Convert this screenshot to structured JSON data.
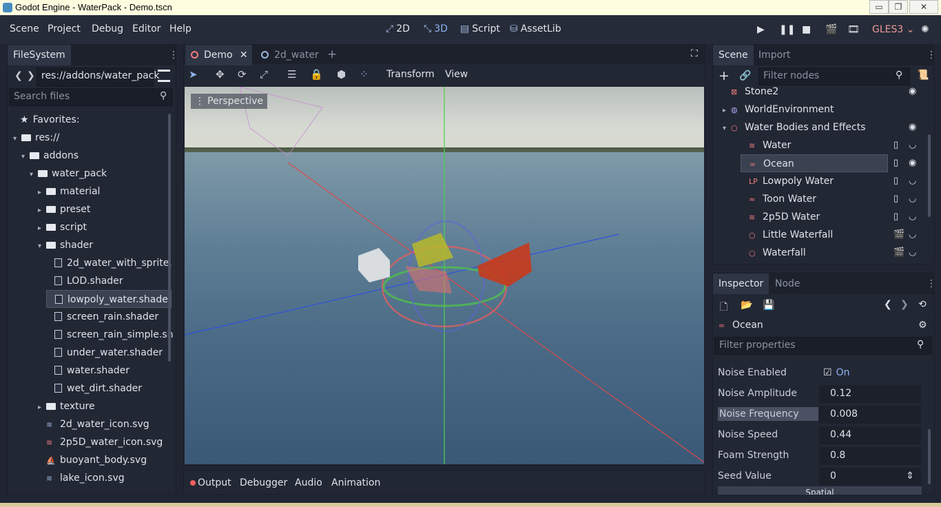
{
  "window": {
    "title": "Godot Engine - WaterPack - Demo.tscn",
    "minimize": "▭",
    "maximize": "❐",
    "close": "✕"
  },
  "menu": {
    "items": [
      "Scene",
      "Project",
      "Debug",
      "Editor",
      "Help"
    ]
  },
  "workspaces": {
    "two_d": "2D",
    "three_d": "3D",
    "script": "Script",
    "assetlib": "AssetLib"
  },
  "run": {
    "renderer": "GLES3"
  },
  "filesystem": {
    "tab": "FileSystem",
    "path": "res://addons/water_pack",
    "search_placeholder": "Search files",
    "favorites": "Favorites:",
    "tree": [
      {
        "label": "res://",
        "kind": "folder",
        "arrow": "▾",
        "indent": 0
      },
      {
        "label": "addons",
        "kind": "folder",
        "arrow": "▾",
        "indent": 1
      },
      {
        "label": "water_pack",
        "kind": "folder",
        "arrow": "▾",
        "indent": 2
      },
      {
        "label": "material",
        "kind": "folder",
        "arrow": "▸",
        "indent": 3
      },
      {
        "label": "preset",
        "kind": "folder",
        "arrow": "▸",
        "indent": 3
      },
      {
        "label": "script",
        "kind": "folder",
        "arrow": "▸",
        "indent": 3
      },
      {
        "label": "shader",
        "kind": "folder",
        "arrow": "▾",
        "indent": 3
      },
      {
        "label": "2d_water_with_sprite.",
        "kind": "file",
        "indent": 4
      },
      {
        "label": "LOD.shader",
        "kind": "file",
        "indent": 4
      },
      {
        "label": "lowpoly_water.shade",
        "kind": "file",
        "indent": 4,
        "selected": true
      },
      {
        "label": "screen_rain.shader",
        "kind": "file",
        "indent": 4
      },
      {
        "label": "screen_rain_simple.sh",
        "kind": "file",
        "indent": 4
      },
      {
        "label": "under_water.shader",
        "kind": "file",
        "indent": 4
      },
      {
        "label": "water.shader",
        "kind": "file",
        "indent": 4
      },
      {
        "label": "wet_dirt.shader",
        "kind": "file",
        "indent": 4
      },
      {
        "label": "texture",
        "kind": "folder",
        "arrow": "▸",
        "indent": 3
      },
      {
        "label": "2d_water_icon.svg",
        "kind": "icon-water",
        "indent": 3
      },
      {
        "label": "2p5D_water_icon.svg",
        "kind": "icon-2p5d",
        "indent": 3
      },
      {
        "label": "buoyant_body.svg",
        "kind": "icon-buoy",
        "indent": 3
      },
      {
        "label": "lake_icon.svg",
        "kind": "icon-water",
        "indent": 3
      }
    ]
  },
  "editor": {
    "tabs": [
      {
        "label": "Demo",
        "active": true
      },
      {
        "label": "2d_water",
        "active": false
      }
    ],
    "toolbar": {
      "transform": "Transform",
      "view": "View"
    },
    "perspective": "Perspective"
  },
  "bottom": {
    "tabs": [
      "Output",
      "Debugger",
      "Audio",
      "Animation"
    ]
  },
  "scene": {
    "tabs": [
      "Scene",
      "Import"
    ],
    "filter_placeholder": "Filter nodes",
    "nodes": [
      {
        "label": "Stone2",
        "indent": 0,
        "icon": "stone"
      },
      {
        "label": "WorldEnvironment",
        "indent": 0,
        "icon": "globe",
        "arrow": "▸"
      },
      {
        "label": "Water Bodies and Effects",
        "indent": 0,
        "icon": "node",
        "arrow": "▾"
      },
      {
        "label": "Water",
        "indent": 1,
        "icon": "wave"
      },
      {
        "label": "Ocean",
        "indent": 1,
        "icon": "ocean",
        "selected": true
      },
      {
        "label": "Lowpoly Water",
        "indent": 1,
        "icon": "lp"
      },
      {
        "label": "Toon Water",
        "indent": 1,
        "icon": "toon"
      },
      {
        "label": "2p5D Water",
        "indent": 1,
        "icon": "2p5d"
      },
      {
        "label": "Little Waterfall",
        "indent": 1,
        "icon": "node"
      },
      {
        "label": "Waterfall",
        "indent": 1,
        "icon": "node"
      }
    ]
  },
  "inspector": {
    "tabs": [
      "Inspector",
      "Node"
    ],
    "object": "Ocean",
    "filter_placeholder": "Filter properties",
    "props": [
      {
        "label": "Noise Enabled",
        "value": "On",
        "checkbox": true
      },
      {
        "label": "Noise Amplitude",
        "value": "0.12"
      },
      {
        "label": "Noise Frequency",
        "value": "0.008",
        "highlight": true
      },
      {
        "label": "Noise Speed",
        "value": "0.44"
      },
      {
        "label": "Foam Strength",
        "value": "0.8"
      },
      {
        "label": "Seed Value",
        "value": "0"
      }
    ],
    "section": "Spatial"
  }
}
